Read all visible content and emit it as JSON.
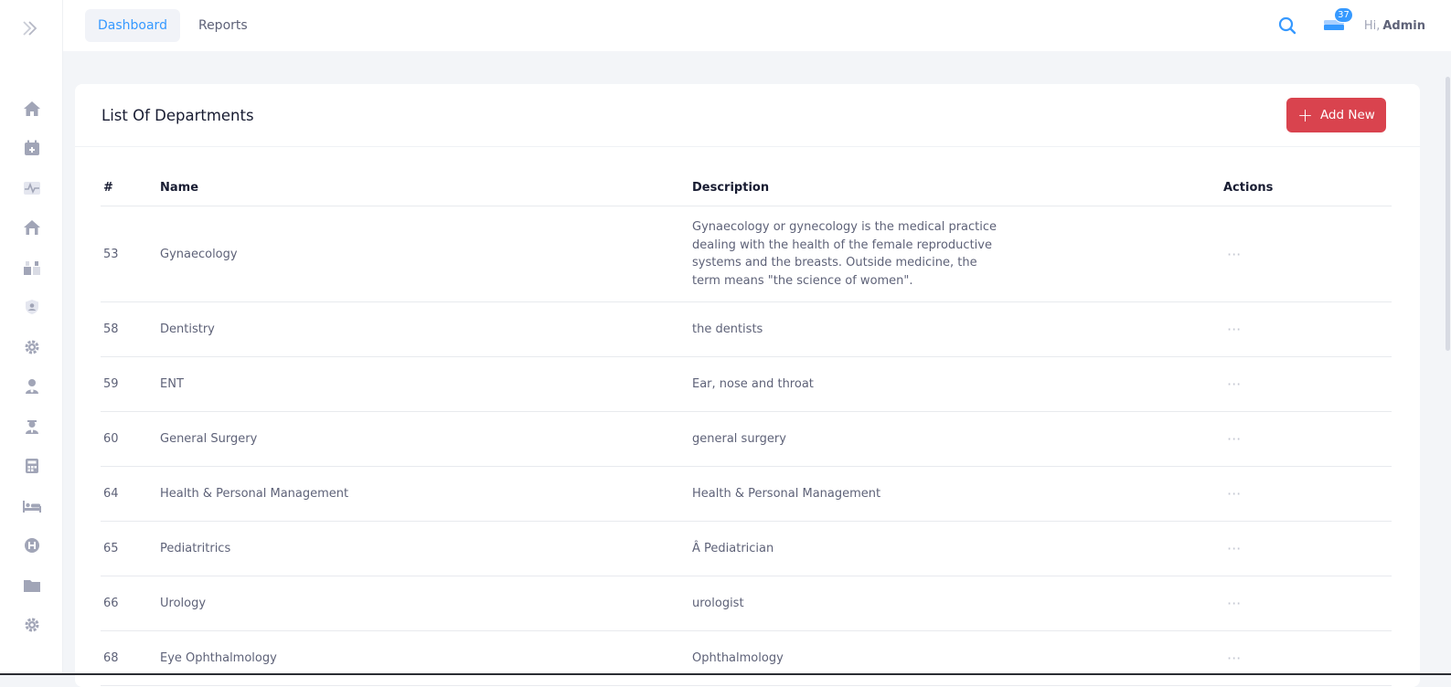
{
  "nav": {
    "tabs": [
      {
        "label": "Dashboard",
        "active": true
      },
      {
        "label": "Reports",
        "active": false
      }
    ],
    "notification_count": "37",
    "greeting": "Hi,",
    "user": "Admin"
  },
  "sidebar": {
    "icons": [
      "home-icon",
      "calendar-plus-icon",
      "heartbeat-icon",
      "house-medical-icon",
      "boxes-icon",
      "shield-user-icon",
      "gear-icon",
      "doctor-icon",
      "nurse-icon",
      "calculator-icon",
      "bed-icon",
      "hospital-h-icon",
      "folder-icon",
      "settings-icon"
    ]
  },
  "card": {
    "title": "List Of Departments",
    "add_label": "Add New"
  },
  "table": {
    "headers": {
      "num": "#",
      "name": "Name",
      "desc": "Description",
      "actions": "Actions"
    },
    "rows": [
      {
        "id": "53",
        "name": "Gynaecology",
        "desc": "Gynaecology or gynecology is the medical practice dealing with the health of the female reproductive systems and the breasts. Outside medicine, the term means \"the science of women\"."
      },
      {
        "id": "58",
        "name": "Dentistry",
        "desc": "the dentists"
      },
      {
        "id": "59",
        "name": "ENT",
        "desc": "Ear, nose and throat"
      },
      {
        "id": "60",
        "name": "General Surgery",
        "desc": "general surgery"
      },
      {
        "id": "64",
        "name": "Health & Personal Management",
        "desc": "Health & Personal Management"
      },
      {
        "id": "65",
        "name": "Pediatritrics",
        "desc": "Â Pediatrician"
      },
      {
        "id": "66",
        "name": "Urology",
        "desc": "urologist"
      },
      {
        "id": "68",
        "name": "Eye Ophthalmology",
        "desc": "Ophthalmology"
      }
    ],
    "action_glyph": "···"
  },
  "colors": {
    "accent": "#3699ff",
    "danger": "#d9434e",
    "icon": "#a1a5b7"
  }
}
